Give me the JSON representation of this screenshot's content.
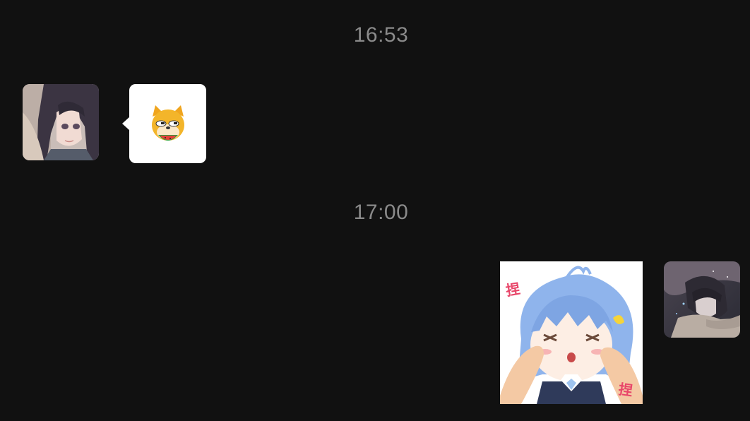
{
  "chat": {
    "messages": [
      {
        "timestamp": "16:53",
        "sender": "contact",
        "kind": "emoji",
        "emoji_icon": "shiba-dog-eating-watermelon-emoji"
      },
      {
        "timestamp": "17:00",
        "sender": "self",
        "kind": "sticker",
        "sticker_icon": "anime-girl-cheek-pinch-sticker",
        "sticker_text": [
          "捏",
          "捏"
        ]
      }
    ],
    "avatars": {
      "contact": "anime-girl-avatar",
      "self": "anime-boy-avatar"
    }
  },
  "colors": {
    "background": "#111111",
    "timestamp_text": "#8a8a8a",
    "bubble_bg": "#ffffff",
    "sticker_text": "#e8476a"
  }
}
